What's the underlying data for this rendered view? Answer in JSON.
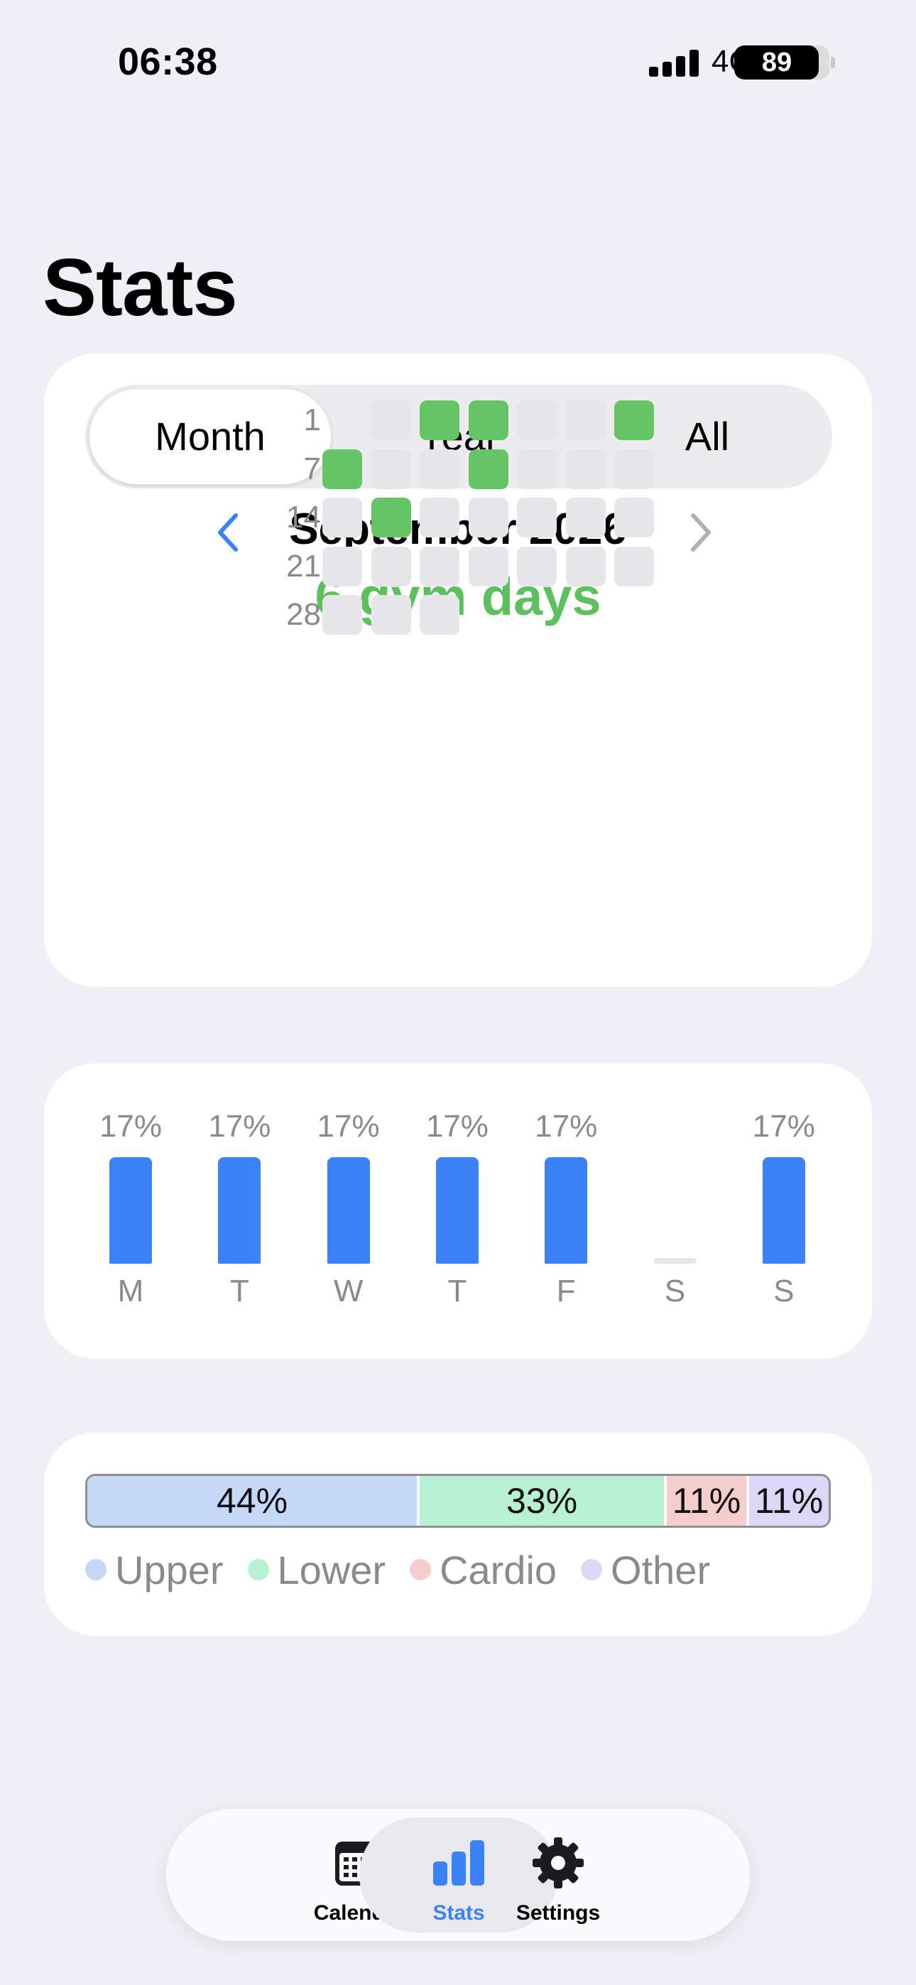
{
  "status_bar": {
    "time": "06:38",
    "network": "4G",
    "battery": 89
  },
  "page": {
    "title": "Stats"
  },
  "segmented": {
    "options": [
      "Month",
      "Year",
      "All"
    ],
    "selected": "Month"
  },
  "month_nav": {
    "label": "September 2026",
    "gym_days": "6 gym days"
  },
  "calendar": {
    "row_labels": [
      "1",
      "7",
      "14",
      "21",
      "28"
    ],
    "first_weekday_index": 1,
    "days_in_month": 30,
    "active_days": [
      2,
      3,
      6,
      7,
      10,
      15
    ],
    "colors": {
      "active": "#65c466",
      "inactive": "#e5e5ea"
    }
  },
  "weekday_chart": {
    "chart_data": {
      "type": "bar",
      "categories": [
        "M",
        "T",
        "W",
        "T",
        "F",
        "S",
        "S"
      ],
      "values": [
        17,
        17,
        17,
        17,
        17,
        0,
        17
      ],
      "labels": [
        "17%",
        "17%",
        "17%",
        "17%",
        "17%",
        "",
        "17%"
      ],
      "ylim": [
        0,
        17
      ],
      "color": "#3b82f6"
    }
  },
  "workout_split": {
    "segments": [
      {
        "name": "Upper",
        "percent": 44,
        "label": "44%",
        "color": "#c4d9f7"
      },
      {
        "name": "Lower",
        "percent": 33,
        "label": "33%",
        "color": "#b8f0d2"
      },
      {
        "name": "Cardio",
        "percent": 11,
        "label": "11%",
        "color": "#f6cdcd"
      },
      {
        "name": "Other",
        "percent": 11,
        "label": "11%",
        "color": "#dcd7f7"
      }
    ]
  },
  "tab_bar": {
    "tabs": [
      {
        "label": "Calendar",
        "icon": "calendar-icon"
      },
      {
        "label": "Stats",
        "icon": "bar-chart-icon"
      },
      {
        "label": "Settings",
        "icon": "gear-icon"
      }
    ],
    "selected": "Stats",
    "accent": "#3b82f6"
  }
}
